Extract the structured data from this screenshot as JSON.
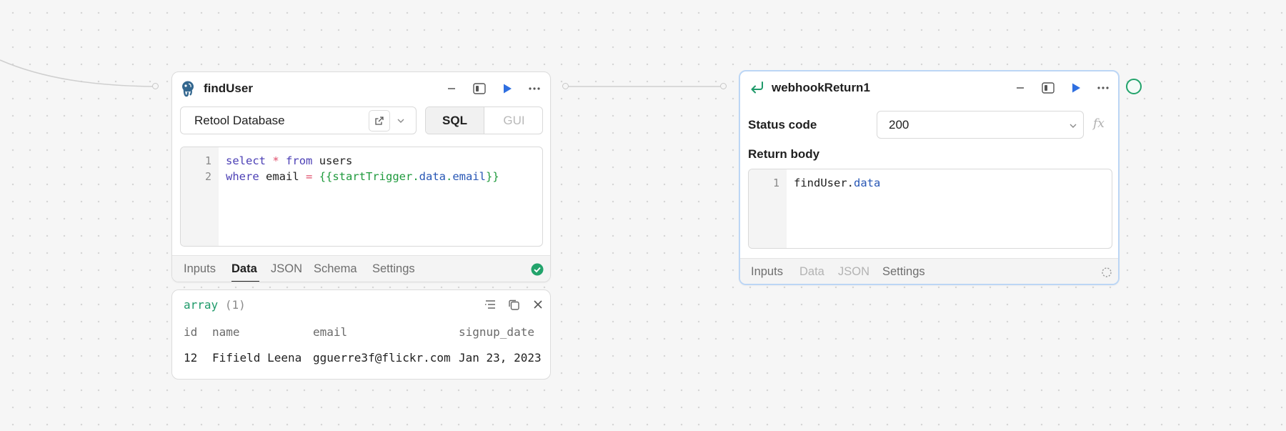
{
  "find_user": {
    "title": "findUser",
    "resource": "Retool Database",
    "mode_sql": "SQL",
    "mode_gui": "GUI",
    "code_lines": [
      {
        "number": "1",
        "tokens": {
          "t1": "select",
          "t2": " ",
          "t3": "*",
          "t4": " ",
          "t5": "from",
          "t6": " users"
        }
      },
      {
        "number": "2",
        "tokens": {
          "t1": "where",
          "t2": " email ",
          "t3": "=",
          "t4": " ",
          "t5": "{{startTrigger.",
          "t6": "data",
          "t7": ".",
          "t8": "email",
          "t9": "}}"
        }
      }
    ],
    "tabs": [
      "Inputs",
      "Data",
      "JSON",
      "Schema",
      "Settings"
    ],
    "active_tab": "Data",
    "status": "success"
  },
  "result": {
    "type_label": "array",
    "count_label": "(1)",
    "columns": [
      "id",
      "name",
      "email",
      "signup_date"
    ],
    "rows": [
      [
        "12",
        "Fifield Leena",
        "gguerre3f@flickr.com",
        "Jan 23, 2023"
      ]
    ]
  },
  "webhook_return": {
    "title": "webhookReturn1",
    "status_code_label": "Status code",
    "status_code_value": "200",
    "fx_label": "fx",
    "return_body_label": "Return body",
    "code_line_number": "1",
    "code_obj": "findUser.",
    "code_prop": "data",
    "tabs": [
      "Inputs",
      "Data",
      "JSON",
      "Settings"
    ],
    "disabled_tabs": [
      "Data",
      "JSON"
    ]
  },
  "colors": {
    "accent_blue": "#2f6fe0",
    "success_green": "#22a36b",
    "selected_border": "#bcd6f5"
  }
}
